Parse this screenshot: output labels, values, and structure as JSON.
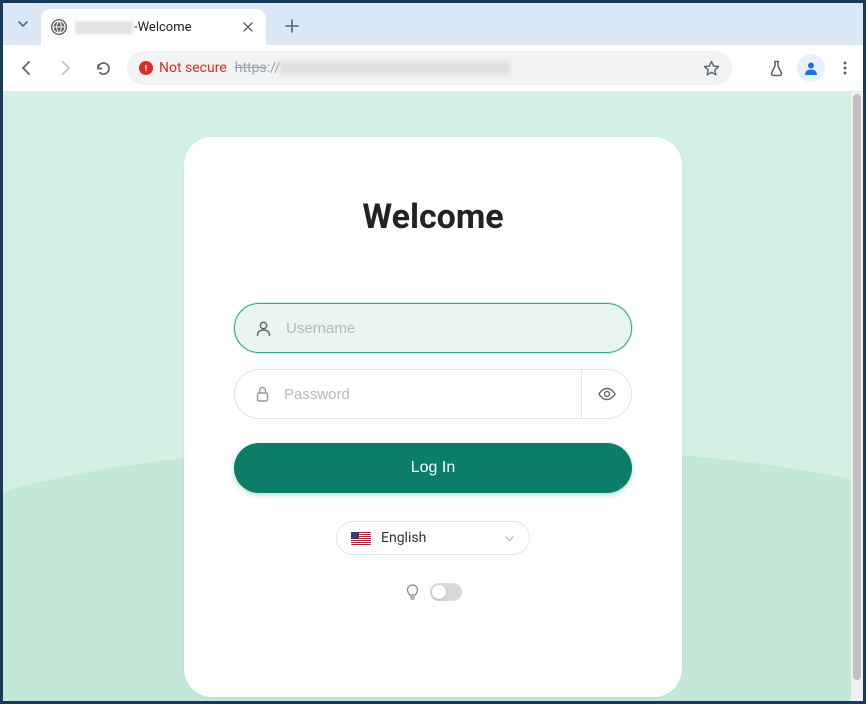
{
  "browser": {
    "tab_title_suffix": "-Welcome",
    "security_label": "Not secure",
    "url_protocol": "https",
    "url_separator": "://"
  },
  "login": {
    "heading": "Welcome",
    "username_placeholder": "Username",
    "username_value": "",
    "password_placeholder": "Password",
    "password_value": "",
    "submit_label": "Log In",
    "language_label": "English"
  }
}
